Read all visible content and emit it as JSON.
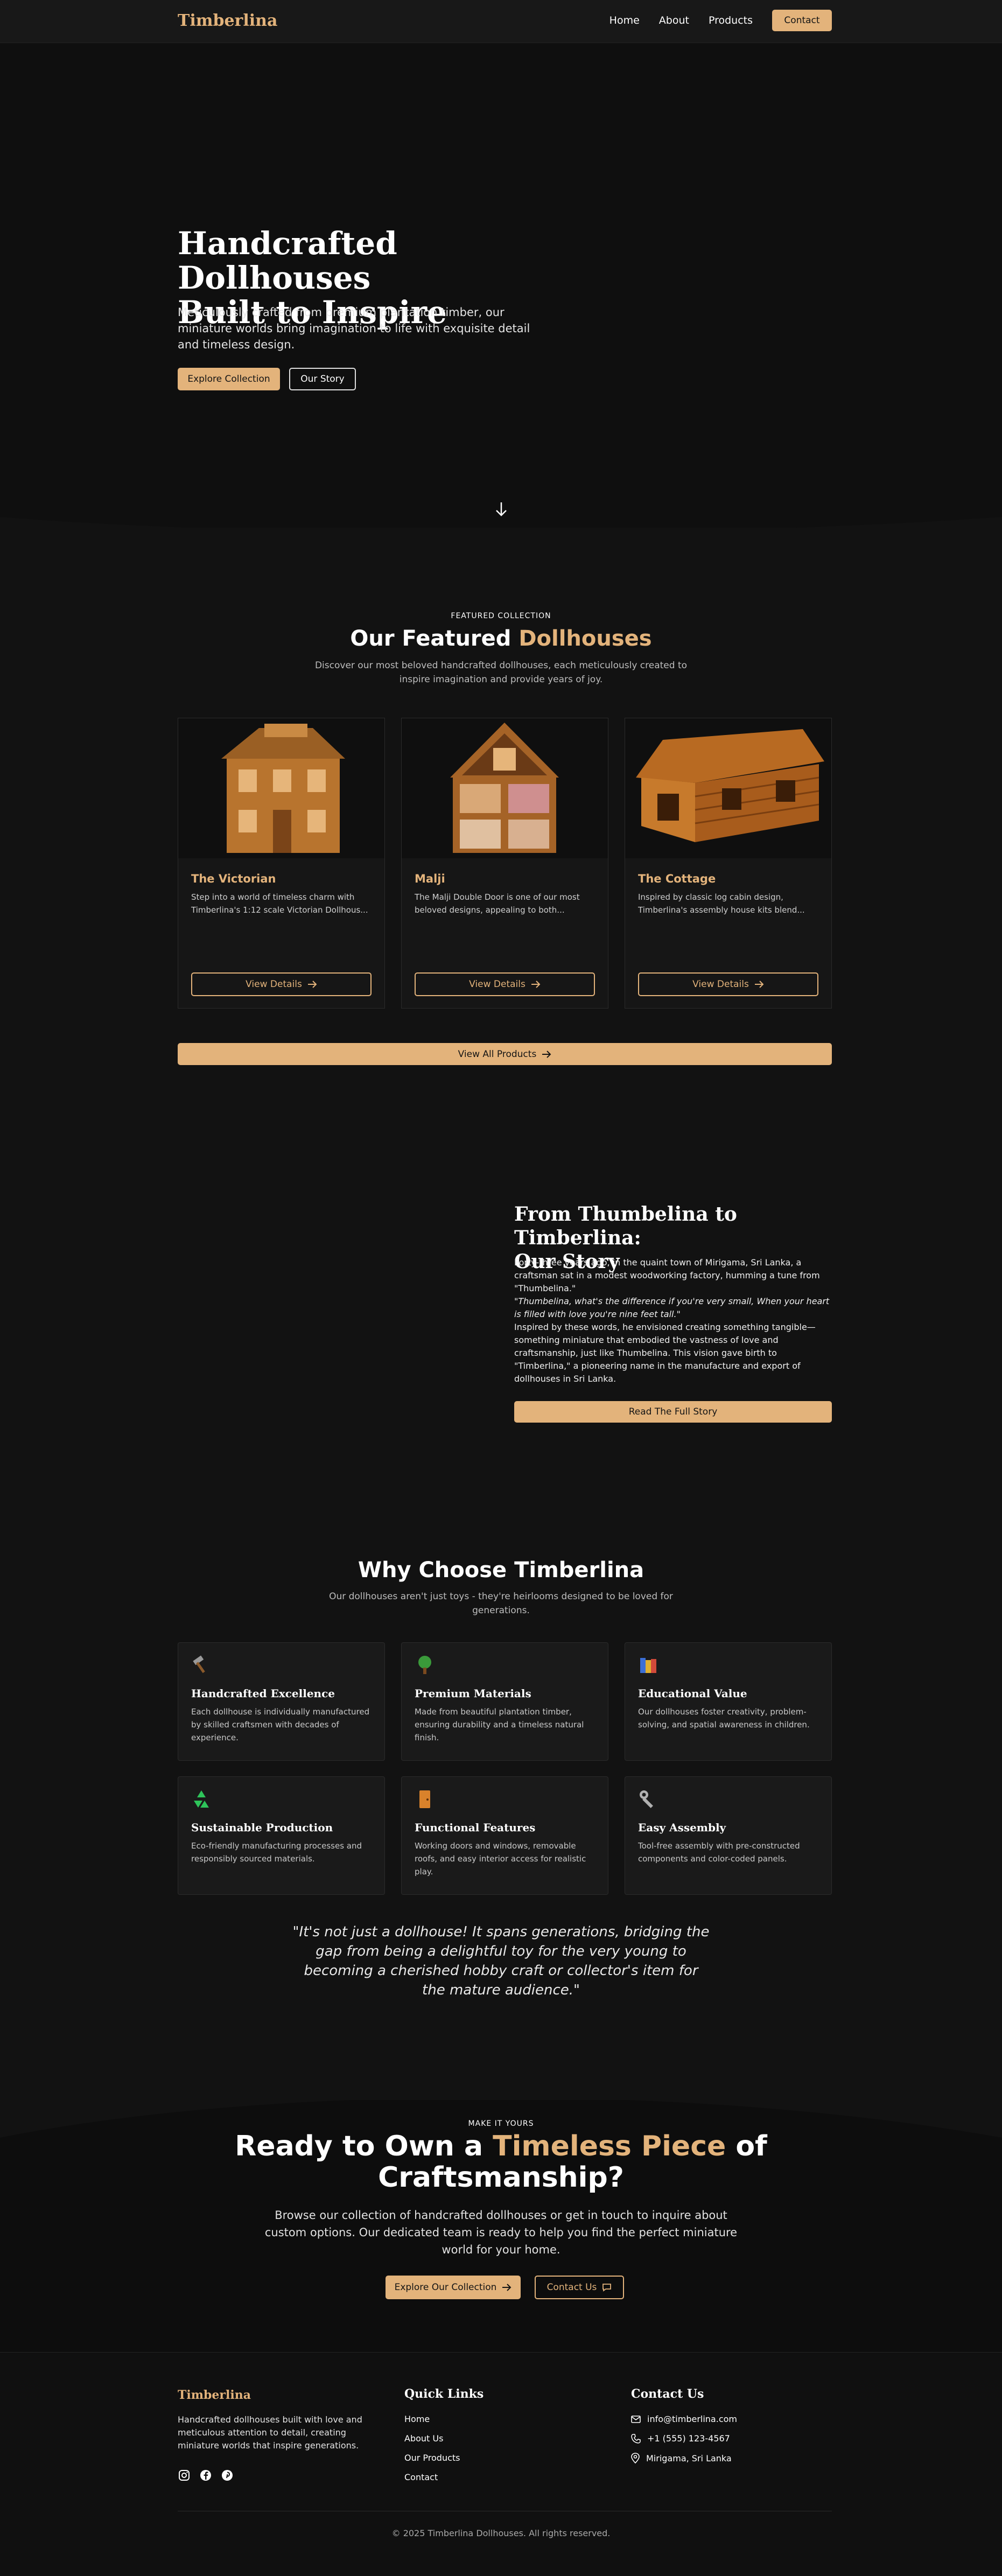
{
  "nav": {
    "logo": "Timberlina",
    "links": [
      "Home",
      "About",
      "Products"
    ],
    "contact_label": "Contact"
  },
  "hero": {
    "title_line1": "Handcrafted Dollhouses",
    "title_line2": "Built to Inspire",
    "subtitle": "Meticulously crafted from premium plantation timber, our miniature worlds bring imagination to life with exquisite detail and timeless design.",
    "primary_button": "Explore Collection",
    "secondary_button": "Our Story"
  },
  "featured": {
    "eyebrow": "FEATURED COLLECTION",
    "title_plain": "Our Featured ",
    "title_accent": "Dollhouses",
    "subtitle": "Discover our most beloved handcrafted dollhouses, each meticulously created to inspire imagination and provide years of joy.",
    "products": [
      {
        "name": "The Victorian",
        "desc": "Step into a world of timeless charm with Timberlina's 1:12 scale Victorian Dollhous...",
        "button": "View Details"
      },
      {
        "name": "Malji",
        "desc": "The Malji Double Door is one of our most beloved designs, appealing to both...",
        "button": "View Details"
      },
      {
        "name": "The Cottage",
        "desc": "Inspired by classic log cabin design, Timberlina's assembly house kits blend...",
        "button": "View Details"
      }
    ],
    "view_all": "View All Products"
  },
  "story": {
    "title_line1": "From Thumbelina to Timberlina:",
    "title_line2": "Our Story",
    "p1": "Forty-three years ago, in the quaint town of Mirigama, Sri Lanka, a craftsman sat in a modest woodworking factory, humming a tune from \"Thumbelina.\"",
    "p2": "\"Thumbelina, what's the difference if you're very small, When your heart is filled with love you're nine feet tall.\"",
    "p3": "Inspired by these words, he envisioned creating something tangible—something miniature that embodied the vastness of love and craftsmanship, just like Thumbelina. This vision gave birth to \"Timberlina,\" a pioneering name in the manufacture and export of dollhouses in Sri Lanka.",
    "button": "Read The Full Story"
  },
  "why": {
    "title": "Why Choose Timberlina",
    "subtitle": "Our dollhouses aren't just toys - they're heirlooms designed to be loved for generations.",
    "features": [
      {
        "icon": "hammer-icon",
        "title": "Handcrafted Excellence",
        "desc": "Each dollhouse is individually manufactured by skilled craftsmen with decades of experience."
      },
      {
        "icon": "tree-icon",
        "title": "Premium Materials",
        "desc": "Made from beautiful plantation timber, ensuring durability and a timeless natural finish."
      },
      {
        "icon": "books-icon",
        "title": "Educational Value",
        "desc": "Our dollhouses foster creativity, problem-solving, and spatial awareness in children."
      },
      {
        "icon": "recycle-icon",
        "title": "Sustainable Production",
        "desc": "Eco-friendly manufacturing processes and responsibly sourced materials."
      },
      {
        "icon": "door-icon",
        "title": "Functional Features",
        "desc": "Working doors and windows, removable roofs, and easy interior access for realistic play."
      },
      {
        "icon": "wrench-icon",
        "title": "Easy Assembly",
        "desc": "Tool-free assembly with pre-constructed components and color-coded panels."
      }
    ],
    "quote": "\"It's not just a dollhouse! It spans generations, bridging the gap from being a delightful toy for the very young to becoming a cherished hobby craft or collector's item for the mature audience.\""
  },
  "cta": {
    "eyebrow": "MAKE IT YOURS",
    "title_plain1": "Ready to Own a ",
    "title_accent": "Timeless Piece",
    "title_plain2": " of Craftsmanship?",
    "subtitle": "Browse our collection of handcrafted dollhouses or get in touch to inquire about custom options. Our dedicated team is ready to help you find the perfect miniature world for your home.",
    "primary_button": "Explore Our Collection",
    "secondary_button": "Contact Us"
  },
  "footer": {
    "logo": "Timberlina",
    "about": "Handcrafted dollhouses built with love and meticulous attention to detail, creating miniature worlds that inspire generations.",
    "quick_links_title": "Quick Links",
    "quick_links": [
      "Home",
      "About Us",
      "Our Products",
      "Contact"
    ],
    "contact_title": "Contact Us",
    "email": "info@timberlina.com",
    "phone": "+1 (555) 123-4567",
    "location": "Mirigama, Sri Lanka",
    "copyright": "© 2025 Timberlina Dollhouses. All rights reserved."
  },
  "colors": {
    "accent": "#e3b37b",
    "background": "#121212",
    "card": "#161616"
  }
}
